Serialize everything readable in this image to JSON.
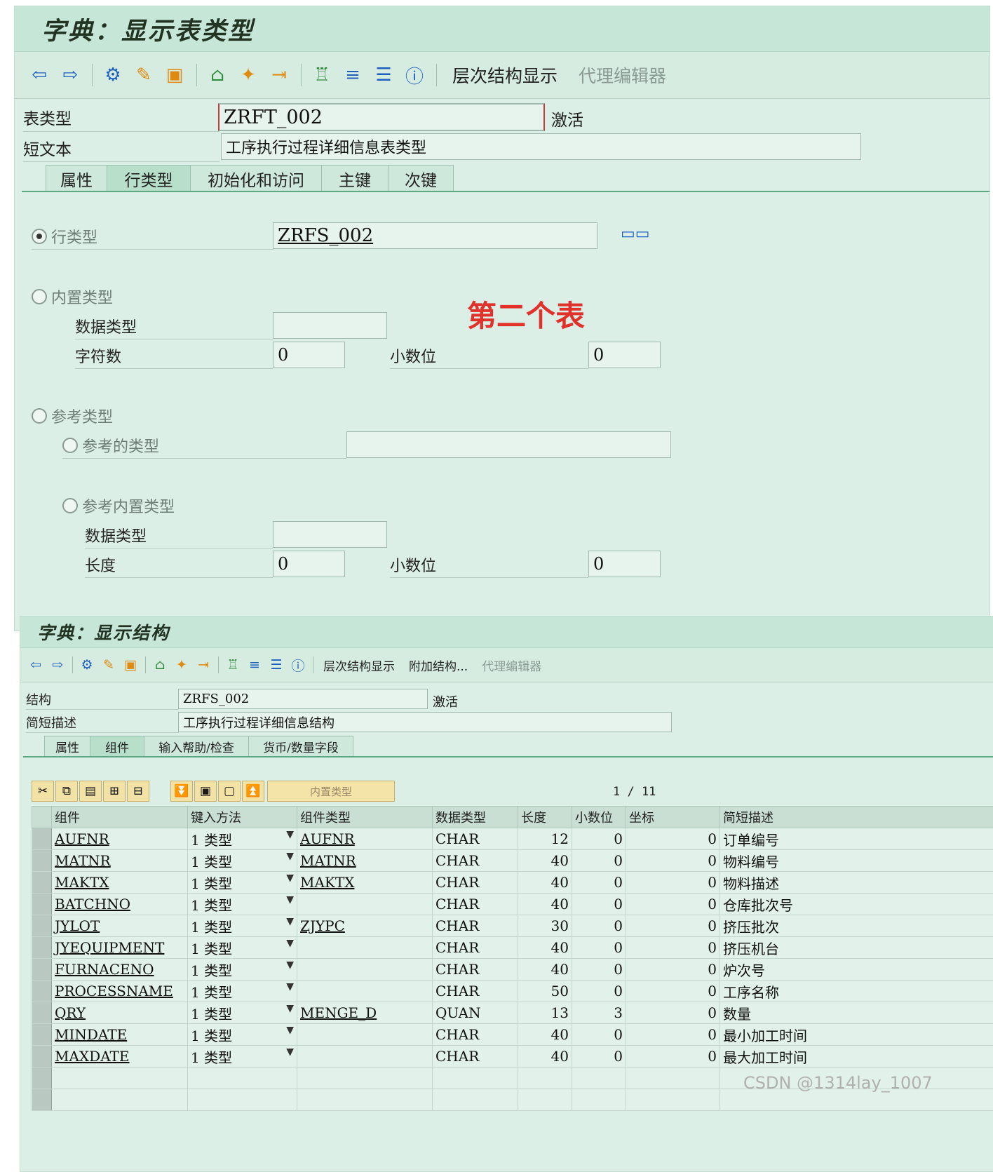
{
  "panel1": {
    "title": "字典：显示表类型",
    "toolbar": {
      "icons": [
        "back-icon",
        "forward-icon",
        "other-object-icon",
        "display-change-icon",
        "activate-icon",
        "where-used-icon",
        "magic-wand-icon",
        "navigate-icon",
        "hierarchy-icon",
        "layout-icon",
        "list-icon",
        "info-icon"
      ],
      "hierarchy_label": "层次结构显示",
      "proxy_label": "代理编辑器"
    },
    "table_type_label": "表类型",
    "table_type_value": "ZRFT_002",
    "status": "激活",
    "short_text_label": "短文本",
    "short_text_value": "工序执行过程详细信息表类型",
    "tabs": [
      "属性",
      "行类型",
      "初始化和访问",
      "主键",
      "次键"
    ],
    "active_tab": "行类型",
    "line_type_label": "行类型",
    "line_type_value": "ZRFS_002",
    "builtin_type_label": "内置类型",
    "data_type_label": "数据类型",
    "data_type_value": "",
    "chars_label": "字符数",
    "chars_value": "0",
    "decimals_label": "小数位",
    "decimals_value": "0",
    "ref_type_label": "参考类型",
    "ref_to_type_label": "参考的类型",
    "ref_to_type_value": "",
    "ref_builtin_label": "参考内置类型",
    "ref_data_type_label": "数据类型",
    "ref_data_type_value": "",
    "length_label": "长度",
    "length_value": "0",
    "ref_decimals_label": "小数位",
    "ref_decimals_value": "0",
    "annotation": "第二个表"
  },
  "panel2": {
    "title": "字典：显示结构",
    "toolbar": {
      "hierarchy_label": "层次结构显示",
      "append_label": "附加结构...",
      "proxy_label": "代理编辑器"
    },
    "structure_label": "结构",
    "structure_value": "ZRFS_002",
    "status": "激活",
    "desc_label": "简短描述",
    "desc_value": "工序执行过程详细信息结构",
    "tabs": [
      "属性",
      "组件",
      "输入帮助/检查",
      "货币/数量字段"
    ],
    "active_tab": "组件",
    "builtin_btn": "内置类型",
    "pager": "1 / 11",
    "columns": [
      "组件",
      "键入方法",
      "组件类型",
      "数据类型",
      "长度",
      "小数位",
      "坐标",
      "简短描述"
    ],
    "rows": [
      {
        "comp": "AUFNR",
        "method": "1 类型",
        "ctype": "AUFNR",
        "dtype": "CHAR",
        "len": "12",
        "dec": "0",
        "coord": "0",
        "desc": "订单编号"
      },
      {
        "comp": "MATNR",
        "method": "1 类型",
        "ctype": "MATNR",
        "dtype": "CHAR",
        "len": "40",
        "dec": "0",
        "coord": "0",
        "desc": "物料编号"
      },
      {
        "comp": "MAKTX",
        "method": "1 类型",
        "ctype": "MAKTX",
        "dtype": "CHAR",
        "len": "40",
        "dec": "0",
        "coord": "0",
        "desc": "物料描述"
      },
      {
        "comp": "BATCHNO",
        "method": "1 类型",
        "ctype": "",
        "dtype": "CHAR",
        "len": "40",
        "dec": "0",
        "coord": "0",
        "desc": "仓库批次号"
      },
      {
        "comp": "JYLOT",
        "method": "1 类型",
        "ctype": "ZJYPC",
        "dtype": "CHAR",
        "len": "30",
        "dec": "0",
        "coord": "0",
        "desc": "挤压批次"
      },
      {
        "comp": "JYEQUIPMENT",
        "method": "1 类型",
        "ctype": "",
        "dtype": "CHAR",
        "len": "40",
        "dec": "0",
        "coord": "0",
        "desc": "挤压机台"
      },
      {
        "comp": "FURNACENO",
        "method": "1 类型",
        "ctype": "",
        "dtype": "CHAR",
        "len": "40",
        "dec": "0",
        "coord": "0",
        "desc": "炉次号"
      },
      {
        "comp": "PROCESSNAME",
        "method": "1 类型",
        "ctype": "",
        "dtype": "CHAR",
        "len": "50",
        "dec": "0",
        "coord": "0",
        "desc": "工序名称"
      },
      {
        "comp": "QRY",
        "method": "1 类型",
        "ctype": "MENGE_D",
        "dtype": "QUAN",
        "len": "13",
        "dec": "3",
        "coord": "0",
        "desc": "数量"
      },
      {
        "comp": "MINDATE",
        "method": "1 类型",
        "ctype": "",
        "dtype": "CHAR",
        "len": "40",
        "dec": "0",
        "coord": "0",
        "desc": "最小加工时间"
      },
      {
        "comp": "MAXDATE",
        "method": "1 类型",
        "ctype": "",
        "dtype": "CHAR",
        "len": "40",
        "dec": "0",
        "coord": "0",
        "desc": "最大加工时间"
      }
    ]
  },
  "watermark": "CSDN @1314lay_1007"
}
